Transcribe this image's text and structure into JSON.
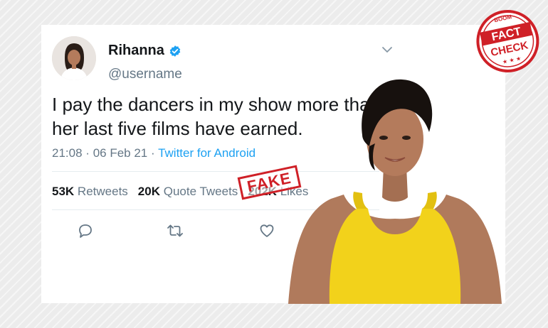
{
  "tweet": {
    "name": "Rihanna",
    "handle": "@username",
    "text": "I pay the dancers in my show more than her last five films have earned.",
    "time": "21:08",
    "date": "06 Feb 21",
    "source": "Twitter for Android",
    "retweets_count": "53K",
    "retweets_label": "Retweets",
    "quotes_count": "20K",
    "quotes_label": "Quote Tweets",
    "likes_count": "202K",
    "likes_label": "Likes"
  },
  "stamp_fake": "FAKE",
  "stamp_factcheck": {
    "top": "BOOM",
    "line1": "FACT",
    "line2": "CHECK"
  },
  "colors": {
    "accent": "#1da1f2",
    "stamp_red": "#cf2027",
    "dress": "#f2d21b"
  },
  "icons": [
    "verified-badge-icon",
    "chevron-down-icon",
    "reply-icon",
    "retweet-icon",
    "like-icon"
  ]
}
